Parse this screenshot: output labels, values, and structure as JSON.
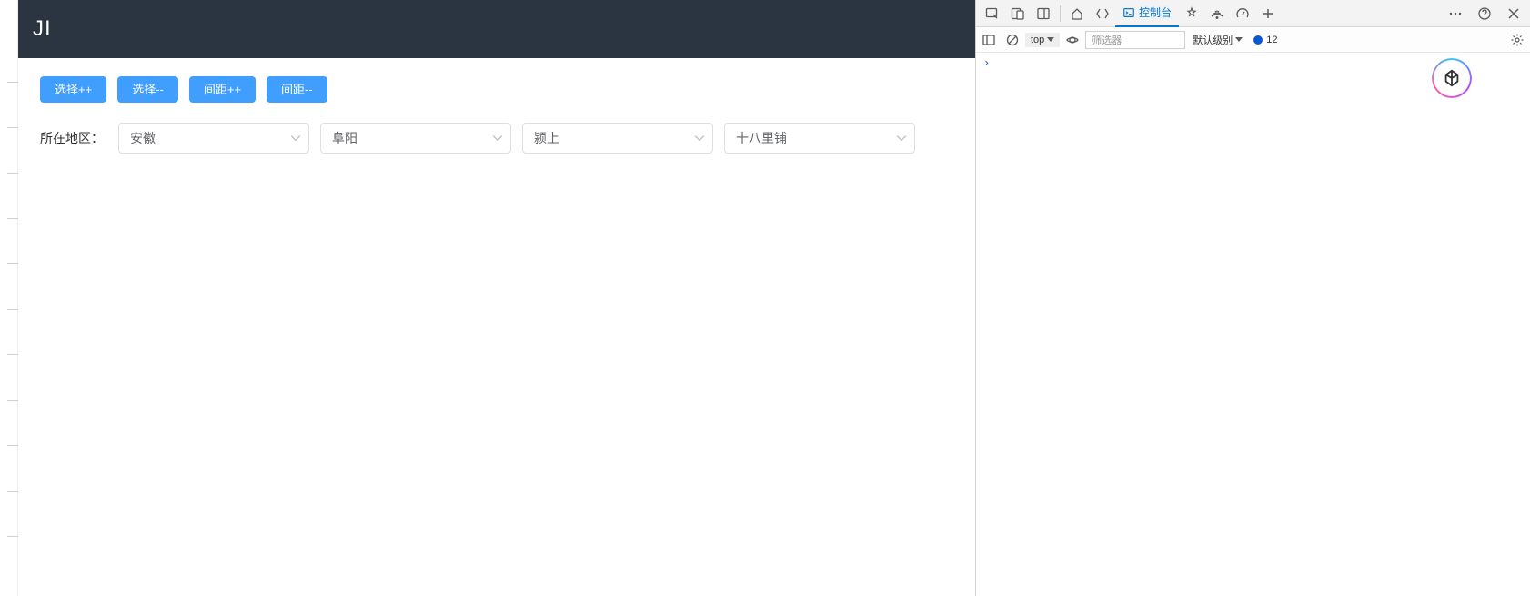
{
  "header": {
    "logo_fragment": "JI"
  },
  "buttons": {
    "select_plus": "选择++",
    "select_minus": "选择--",
    "gap_plus": "间距++",
    "gap_minus": "间距--"
  },
  "region": {
    "label": "所在地区：",
    "province": "安徽",
    "city": "阜阳",
    "county": "颍上",
    "town": "十八里铺"
  },
  "devtools": {
    "tabs": {
      "console": "控制台"
    },
    "toolbar": {
      "context": "top",
      "filter_placeholder": "筛选器",
      "level": "默认级别",
      "issue_count": "12"
    }
  }
}
